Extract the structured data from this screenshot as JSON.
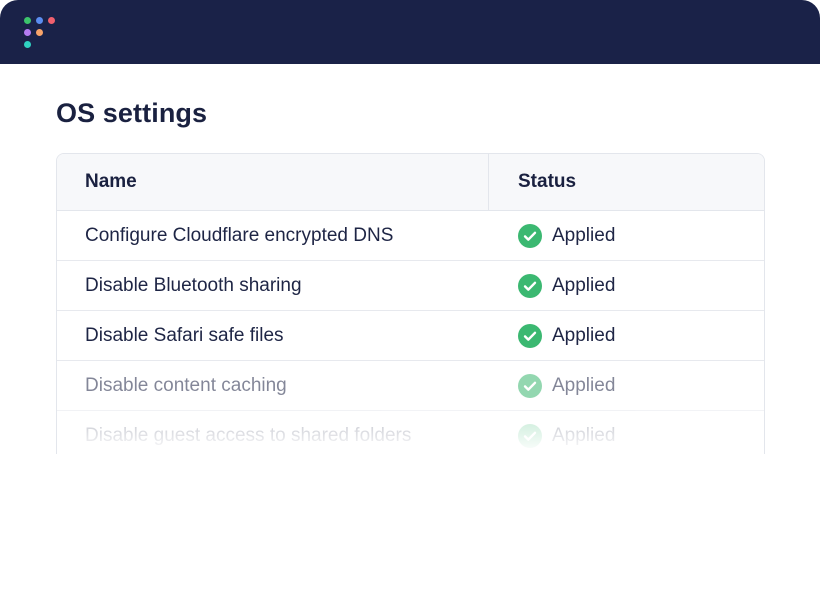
{
  "header": {
    "logo_dots": [
      {
        "color": "#3cc46c"
      },
      {
        "color": "#5b8df0"
      },
      {
        "color": "#f0606e"
      },
      {
        "color": "#b47cf2"
      },
      {
        "color": "#f8a46a"
      },
      {
        "color": "#2fd2c2"
      }
    ]
  },
  "page": {
    "title": "OS settings"
  },
  "table": {
    "columns": {
      "name": "Name",
      "status": "Status"
    },
    "rows": [
      {
        "name": "Configure Cloudflare encrypted DNS",
        "status": "Applied"
      },
      {
        "name": "Disable Bluetooth sharing",
        "status": "Applied"
      },
      {
        "name": "Disable Safari safe files",
        "status": "Applied"
      },
      {
        "name": "Disable content caching",
        "status": "Applied"
      },
      {
        "name": "Disable guest access to shared folders",
        "status": "Applied"
      }
    ]
  },
  "colors": {
    "header_bg": "#1a2248",
    "applied_green": "#3bb871"
  }
}
